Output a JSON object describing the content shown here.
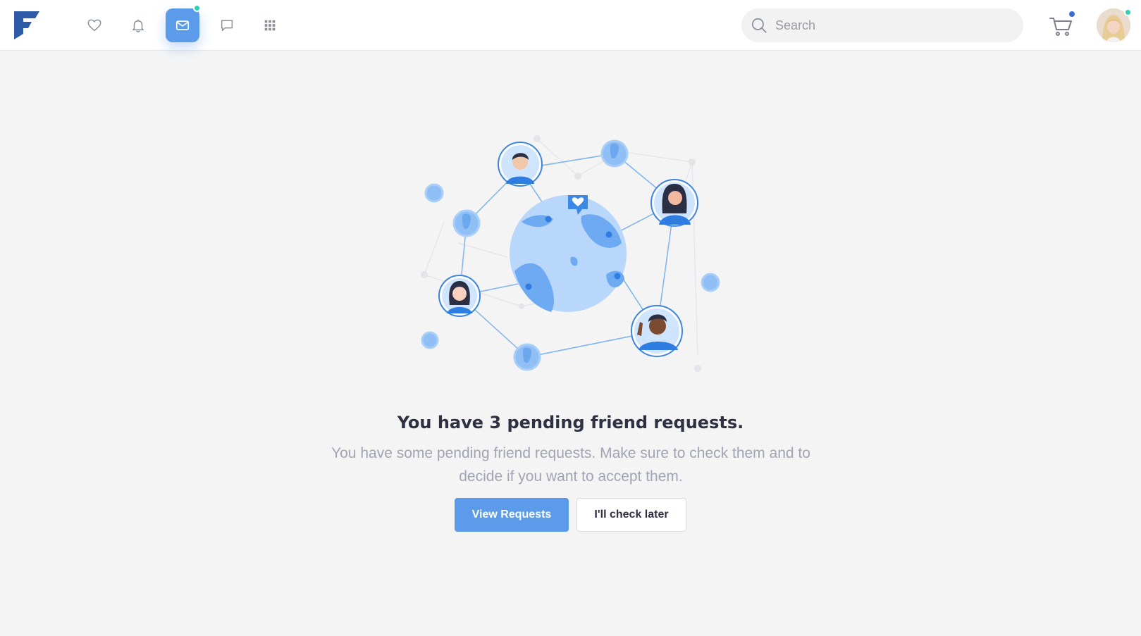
{
  "navbar": {
    "icons": [
      {
        "name": "heart-icon",
        "active": false
      },
      {
        "name": "bell-icon",
        "active": false
      },
      {
        "name": "mail-icon",
        "active": true
      },
      {
        "name": "chat-bubble-icon",
        "active": false
      },
      {
        "name": "apps-grid-icon",
        "active": false
      }
    ],
    "search": {
      "placeholder": "Search"
    },
    "cart": {
      "icon": "cart-icon"
    }
  },
  "main": {
    "headline": "You have 3 pending friend requests.",
    "subtitle": "You have some pending friend requests. Make sure to check them and to decide if you want to accept them.",
    "primary_button": "View Requests",
    "secondary_button": "I'll check later"
  },
  "colors": {
    "accent": "#5b9bea",
    "logo": "#2f5aa8",
    "notification_dot": "#2ed1b2",
    "cart_dot": "#3b6fcf",
    "headline": "#2f3143",
    "subtitle": "#a2a3b3",
    "background": "#f4f4f4"
  }
}
